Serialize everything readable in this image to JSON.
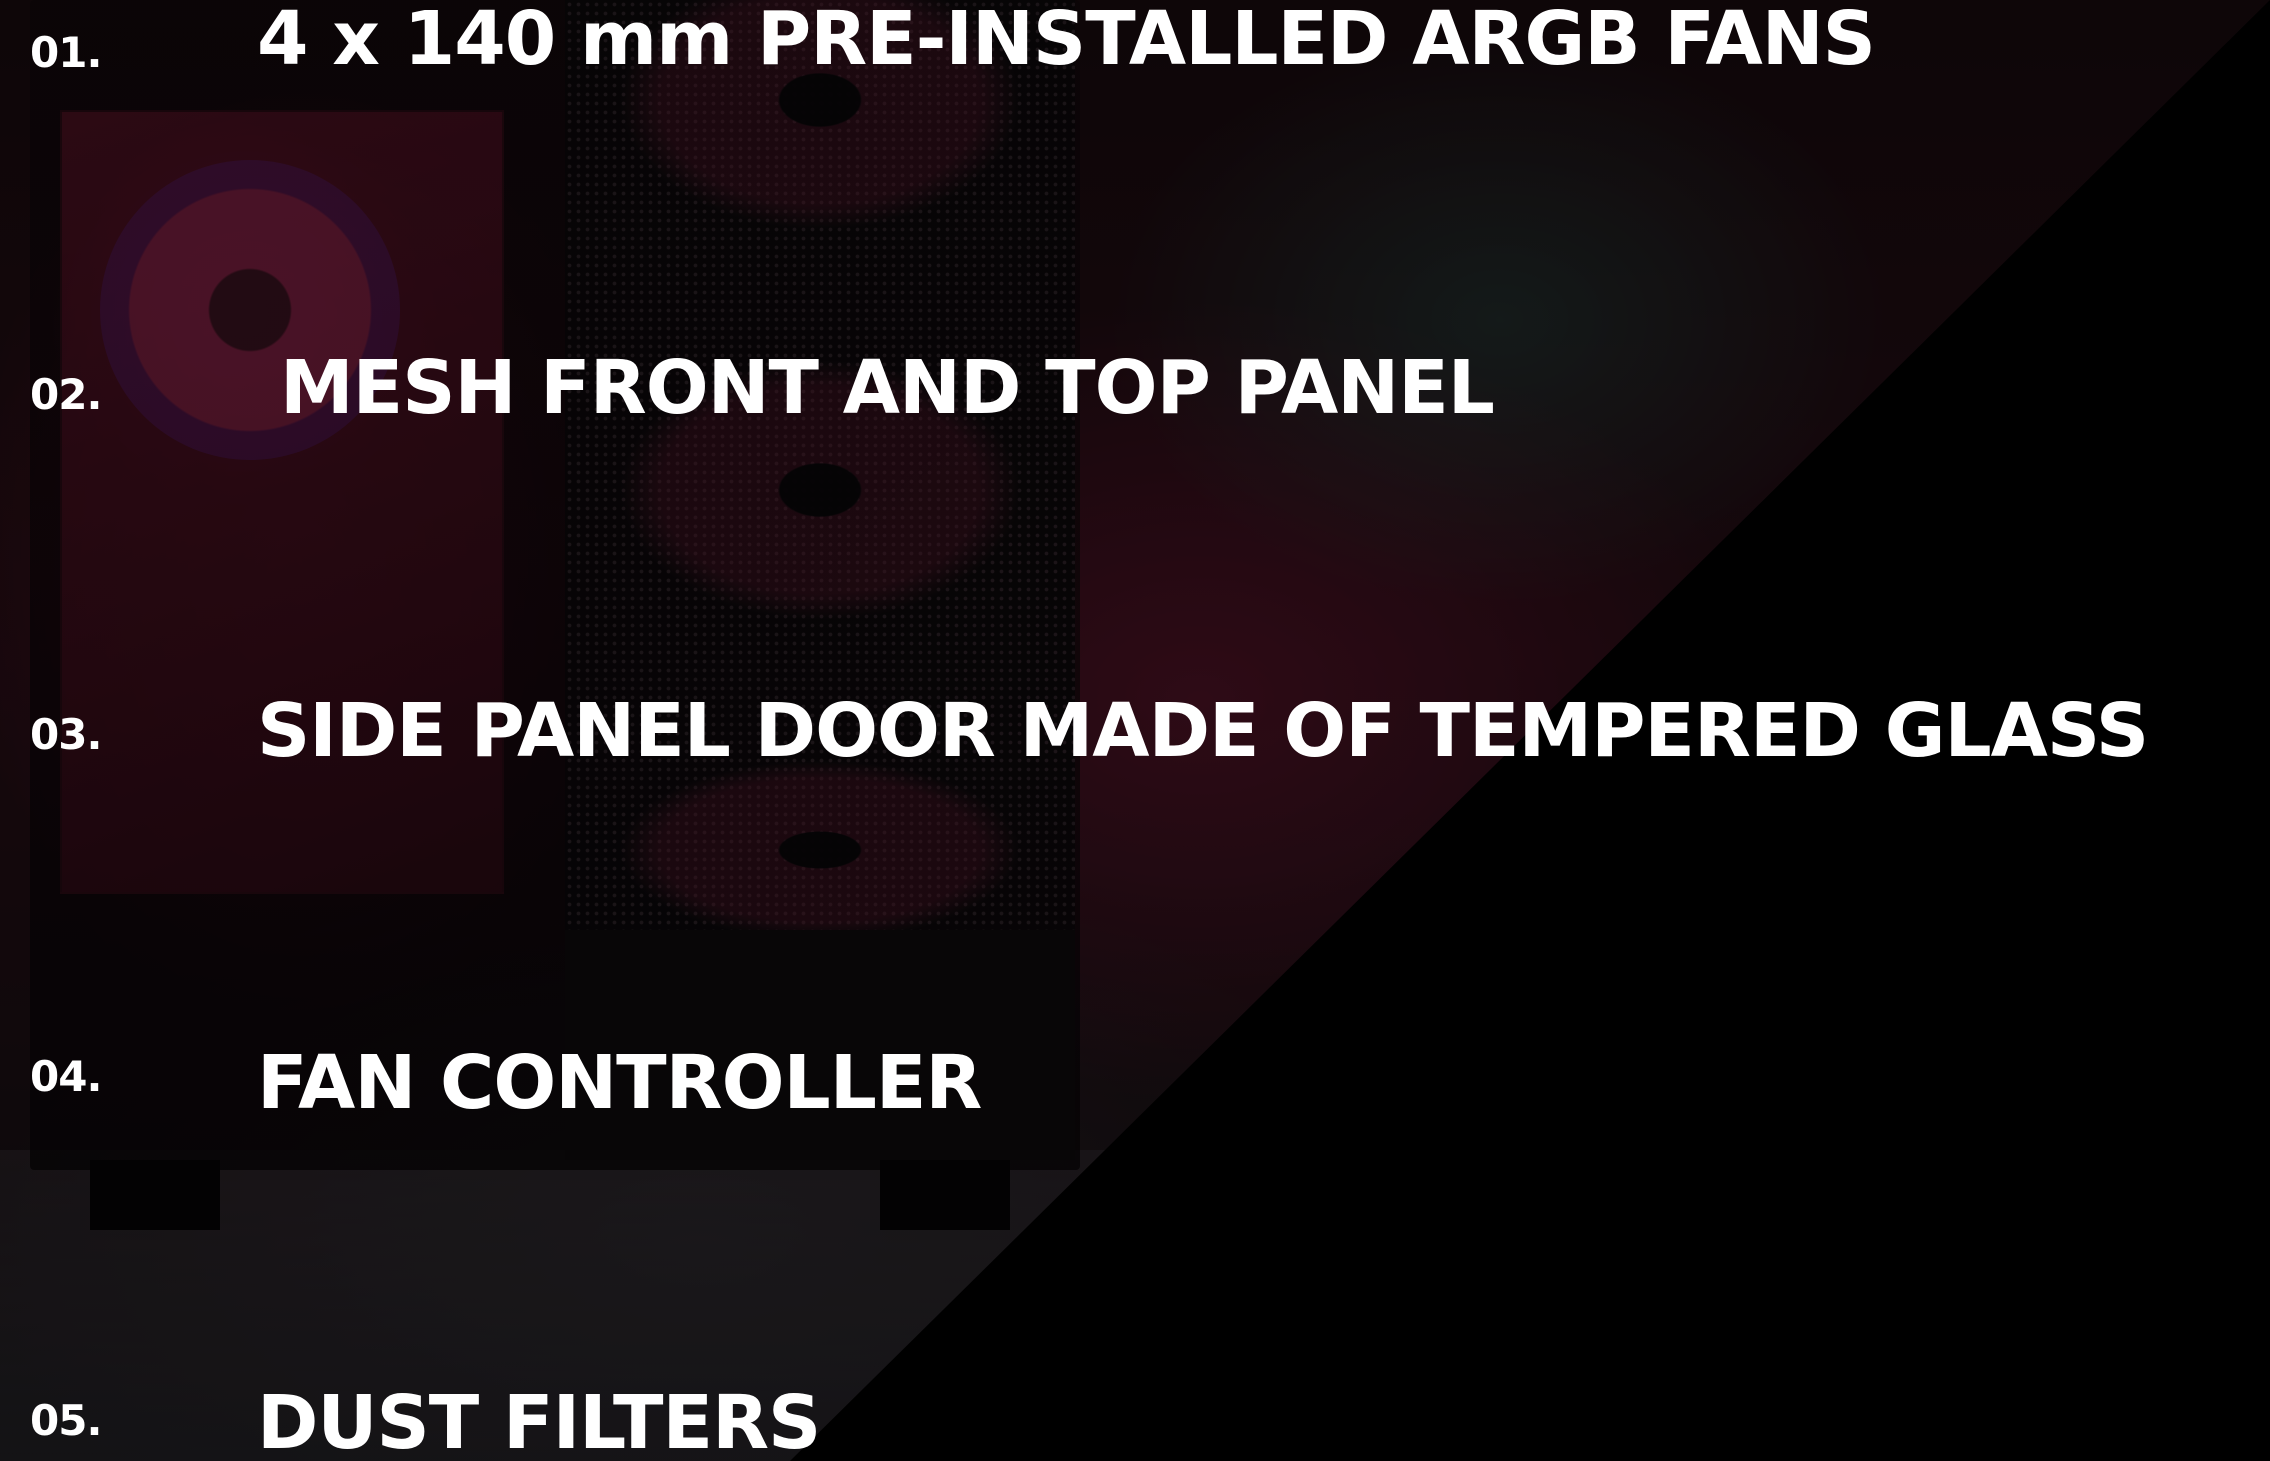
{
  "features": [
    {
      "number": "01.",
      "label": "4 x 140 mm PRE-INSTALLED ARGB FANS"
    },
    {
      "number": "02.",
      "label": "MESH FRONT AND TOP PANEL"
    },
    {
      "number": "03.",
      "label": "SIDE PANEL DOOR MADE OF TEMPERED GLASS"
    },
    {
      "number": "04.",
      "label": "FAN CONTROLLER"
    },
    {
      "number": "05.",
      "label": "DUST FILTERS"
    }
  ],
  "colors": {
    "text": "#ffffff",
    "overlay": "#000000",
    "accent_glow": "#be285a"
  }
}
